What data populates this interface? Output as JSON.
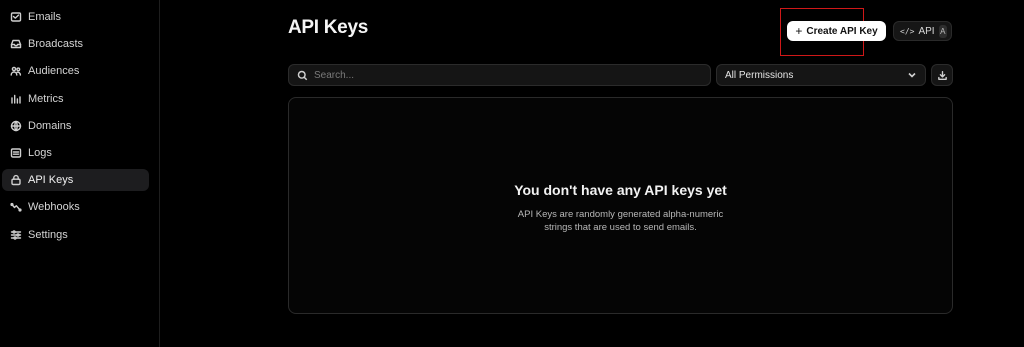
{
  "sidebar": {
    "items": [
      {
        "label": "Emails",
        "icon": "mail-icon",
        "active": false
      },
      {
        "label": "Broadcasts",
        "icon": "inbox-icon",
        "active": false
      },
      {
        "label": "Audiences",
        "icon": "users-icon",
        "active": false
      },
      {
        "label": "Metrics",
        "icon": "bar-chart-icon",
        "active": false
      },
      {
        "label": "Domains",
        "icon": "globe-icon",
        "active": false
      },
      {
        "label": "Logs",
        "icon": "list-icon",
        "active": false
      },
      {
        "label": "API Keys",
        "icon": "lock-icon",
        "active": true
      },
      {
        "label": "Webhooks",
        "icon": "webhook-icon",
        "active": false
      },
      {
        "label": "Settings",
        "icon": "sliders-icon",
        "active": false
      }
    ]
  },
  "header": {
    "title": "API Keys",
    "create_button_label": "Create API Key",
    "api_button_label": "API",
    "api_shortcut": "A"
  },
  "toolbar": {
    "search_placeholder": "Search...",
    "search_value": "",
    "permissions_selected": "All Permissions"
  },
  "empty_state": {
    "title": "You don't have any API keys yet",
    "description": "API Keys are randomly generated alpha-numeric strings that are used to send emails."
  },
  "colors": {
    "background": "#000000",
    "primary_button": "#ffffff",
    "highlight": "#d01818"
  }
}
